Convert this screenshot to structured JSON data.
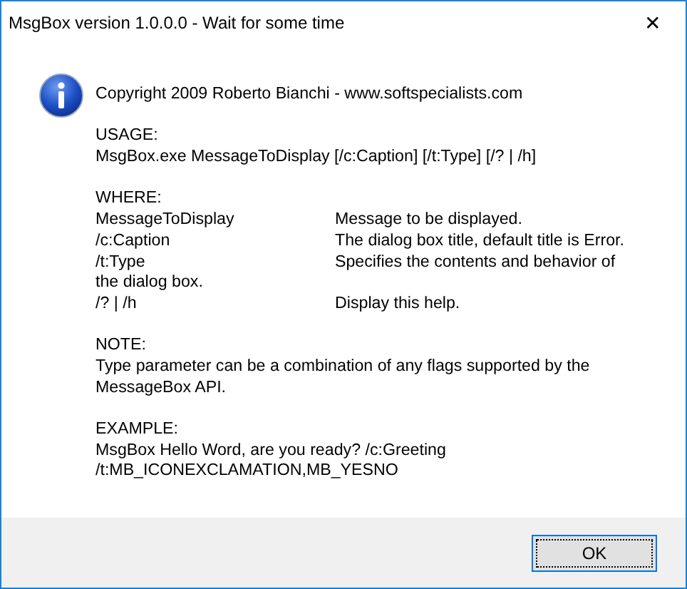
{
  "window": {
    "title": "MsgBox version 1.0.0.0 - Wait for some time",
    "close": "✕"
  },
  "message": [
    {
      "kind": "text",
      "text": "Copyright 2009 Roberto Bianchi - www.softspecialists.com"
    },
    {
      "kind": "gap"
    },
    {
      "kind": "text",
      "text": "USAGE:"
    },
    {
      "kind": "text",
      "text": "MsgBox.exe MessageToDisplay [/c:Caption] [/t:Type] [/? | /h]"
    },
    {
      "kind": "gap"
    },
    {
      "kind": "text",
      "text": "WHERE:"
    },
    {
      "kind": "pair",
      "left": "MessageToDisplay",
      "right": "Message to be displayed."
    },
    {
      "kind": "pair",
      "left": "/c:Caption",
      "right": "The dialog box title, default title is Error."
    },
    {
      "kind": "pair",
      "left": "/t:Type",
      "right": "Specifies the contents and behavior of"
    },
    {
      "kind": "text",
      "text": "the dialog box."
    },
    {
      "kind": "pair",
      "left": "/? | /h",
      "right": "Display this help."
    },
    {
      "kind": "gap"
    },
    {
      "kind": "text",
      "text": "NOTE:"
    },
    {
      "kind": "text",
      "text": "Type parameter can be a combination of any flags supported by the"
    },
    {
      "kind": "text",
      "text": "MessageBox API."
    },
    {
      "kind": "gap"
    },
    {
      "kind": "text",
      "text": "EXAMPLE:"
    },
    {
      "kind": "text",
      "text": "MsgBox Hello Word, are you ready? /c:Greeting"
    },
    {
      "kind": "text",
      "text": "/t:MB_ICONEXCLAMATION,MB_YESNO"
    }
  ],
  "buttons": [
    {
      "label": "OK",
      "focused": true
    }
  ]
}
